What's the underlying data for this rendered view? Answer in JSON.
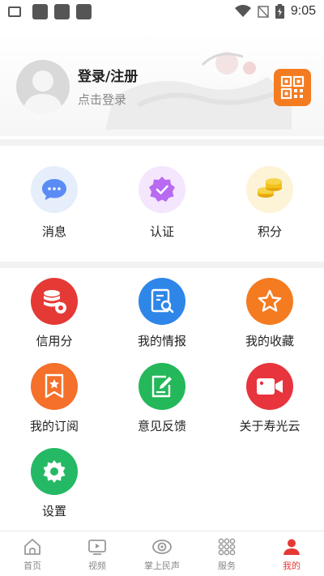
{
  "status_bar": {
    "time": "9:05",
    "icons": [
      "message-icon",
      "app-icon",
      "app-icon",
      "app-icon",
      "wifi-icon",
      "no-signal-icon",
      "battery-icon"
    ]
  },
  "profile": {
    "title": "登录/注册",
    "subtitle": "点击登录",
    "avatar_icon": "avatar-placeholder-icon",
    "qr_icon": "qr-code-icon"
  },
  "quick_actions": [
    {
      "label": "消息",
      "icon": "message-bubble-icon",
      "color": "#5b8cf5"
    },
    {
      "label": "认证",
      "icon": "badge-check-icon",
      "color": "#b86af0"
    },
    {
      "label": "积分",
      "icon": "coins-icon",
      "color": "#f2c21b"
    }
  ],
  "services": [
    {
      "label": "信用分",
      "icon": "database-icon",
      "color": "#e53935"
    },
    {
      "label": "我的情报",
      "icon": "report-icon",
      "color": "#2e86e8"
    },
    {
      "label": "我的收藏",
      "icon": "star-icon",
      "color": "#f57b20"
    },
    {
      "label": "我的订阅",
      "icon": "bookmark-star-icon",
      "color": "#f5702a"
    },
    {
      "label": "意见反馈",
      "icon": "edit-note-icon",
      "color": "#25b85a"
    },
    {
      "label": "关于寿光云",
      "icon": "video-camera-icon",
      "color": "#e8343d"
    },
    {
      "label": "设置",
      "icon": "gear-icon",
      "color": "#25b865"
    }
  ],
  "bottom_nav": [
    {
      "label": "首页",
      "icon": "home-icon",
      "active": false
    },
    {
      "label": "视频",
      "icon": "video-play-icon",
      "active": false
    },
    {
      "label": "掌上民声",
      "icon": "eye-icon",
      "active": false
    },
    {
      "label": "服务",
      "icon": "grid-dots-icon",
      "active": false
    },
    {
      "label": "我的",
      "icon": "user-icon",
      "active": true
    }
  ],
  "colors": {
    "accent": "#e53935",
    "qr_button": "#f57b20"
  }
}
